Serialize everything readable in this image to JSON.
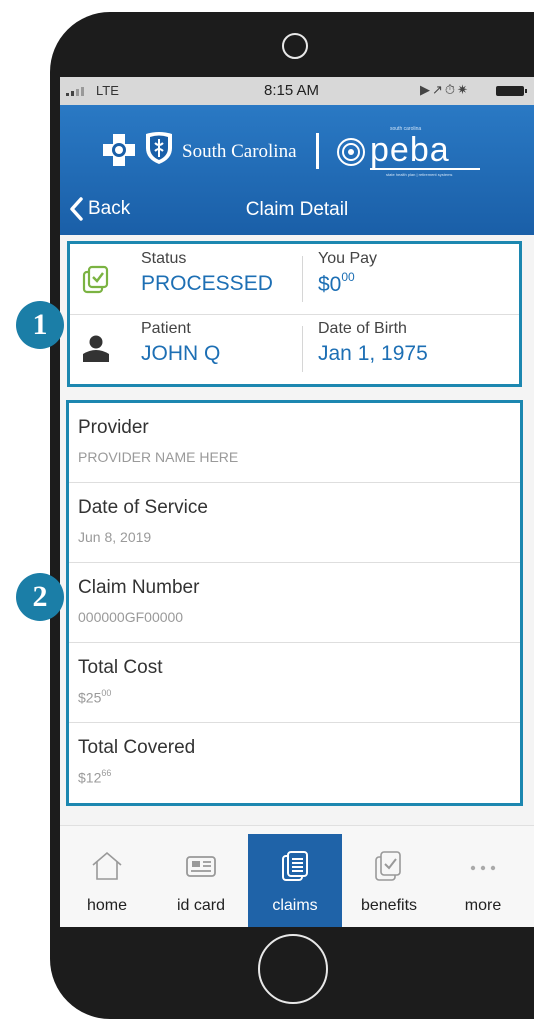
{
  "status_bar": {
    "carrier": "LTE",
    "time": "8:15 AM"
  },
  "header": {
    "brand_name": "South Carolina",
    "peba_word": "peba",
    "peba_top_text": "south carolina",
    "peba_bottom_text": "state health plan | retirement systems",
    "back_label": "Back",
    "title": "Claim Detail"
  },
  "summary": {
    "status_label": "Status",
    "status_value": "PROCESSED",
    "you_pay_label": "You Pay",
    "you_pay_main": "$0",
    "you_pay_cents": "00",
    "patient_label": "Patient",
    "patient_value": "JOHN Q",
    "dob_label": "Date of Birth",
    "dob_value": "Jan 1, 1975"
  },
  "details": {
    "provider_label": "Provider",
    "provider_value": "PROVIDER NAME HERE",
    "service_label": "Date of Service",
    "service_value": "Jun 8, 2019",
    "claim_label": "Claim Number",
    "claim_value": "000000GF00000",
    "total_cost_label": "Total Cost",
    "total_cost_main": "$25",
    "total_cost_cents": "00",
    "total_covered_label": "Total Covered",
    "total_covered_main": "$12",
    "total_covered_cents": "66"
  },
  "callouts": {
    "one": "1",
    "two": "2"
  },
  "tabs": {
    "home": "home",
    "id_card": "id card",
    "claims": "claims",
    "benefits": "benefits",
    "more": "more",
    "active": "claims"
  },
  "colors": {
    "brand_blue": "#1f63a8",
    "value_blue": "#1d6fb4",
    "callout_teal": "#1b7ea7",
    "status_green": "#7bb342"
  },
  "icons": {
    "status": "checked-document-icon",
    "patient": "person-icon",
    "home": "house-icon",
    "id_card": "id-card-icon",
    "claims": "document-stack-icon",
    "benefits": "checklist-icon",
    "more": "ellipsis-icon"
  }
}
